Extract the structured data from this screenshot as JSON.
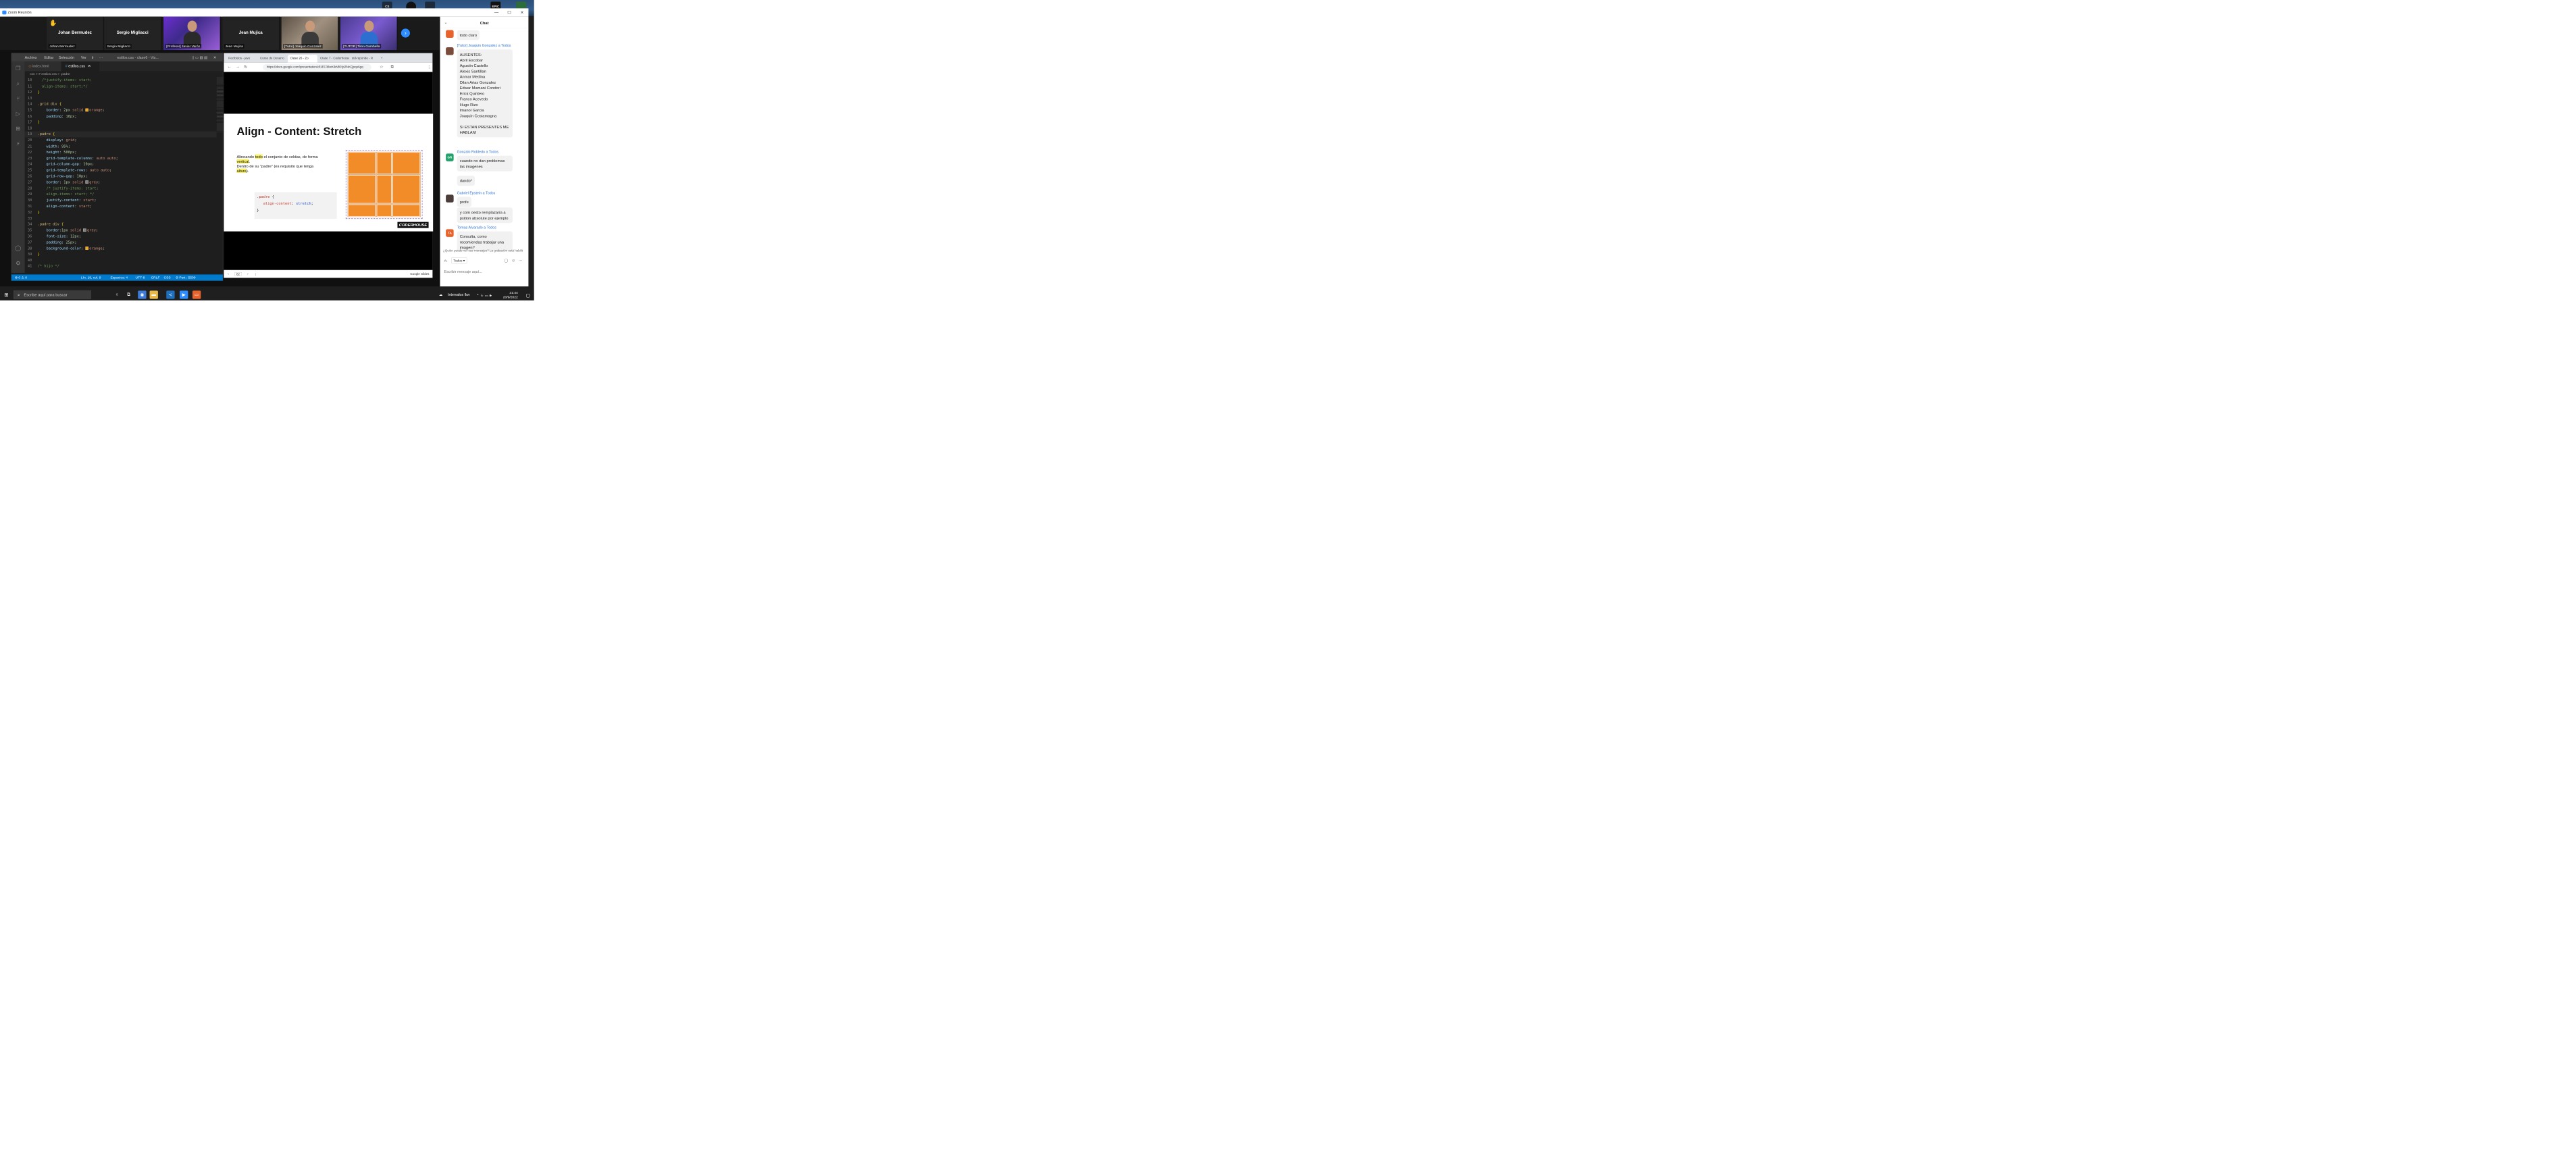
{
  "zoom": {
    "window_title": "Zoom Reunión",
    "minimize": "—",
    "maximize": "☐",
    "close": "✕"
  },
  "desktop": {
    "icons": [
      "CS",
      "",
      "EPIC",
      ""
    ]
  },
  "participants": [
    {
      "name": "Johan Bermudez",
      "tag": "Johan Bermudez",
      "hand": "✋"
    },
    {
      "name": "Sergio Migliacci",
      "tag": "Sergio Migliacci"
    },
    {
      "name": "",
      "tag": "[Profesor] Javier Varón"
    },
    {
      "name": "Jean Mujica",
      "tag": "Jean Mujica"
    },
    {
      "name": "",
      "tag": "[Tutor] Joaquin Gonzalez"
    },
    {
      "name": "",
      "tag": "[TUTOR] Timo Gambella"
    }
  ],
  "vscode": {
    "menu": [
      "Archivo",
      "Editar",
      "Selección",
      "Ver",
      "Ir",
      "···"
    ],
    "title": "estilos.css - clase6 - Vis...",
    "tabs": [
      "index.html",
      "estilos.css"
    ],
    "breadcrumb": "css > # estilos.css > .padre",
    "code_lines": [
      {
        "n": "10",
        "html": "<span class='tok-com'>  /*justify-items: start;</span>"
      },
      {
        "n": "11",
        "html": "<span class='tok-com'>  align-items: start;*/</span>"
      },
      {
        "n": "12",
        "html": "<span class='tok-brace'>}</span>"
      },
      {
        "n": "13",
        "html": ""
      },
      {
        "n": "14",
        "html": "<span class='tok-sel'>.grid div</span> <span class='tok-brace'>{</span>"
      },
      {
        "n": "15",
        "html": "    <span class='tok-prop'>border</span>: <span class='tok-num'>2px</span> <span class='tok-val'>solid</span> <span class='swatch' style='background:#ffa500'></span><span class='tok-val'>orange</span>;"
      },
      {
        "n": "16",
        "html": "    <span class='tok-prop'>padding</span>: <span class='tok-num'>10px</span>;"
      },
      {
        "n": "17",
        "html": "<span class='tok-brace'>}</span>"
      },
      {
        "n": "18",
        "html": ""
      },
      {
        "n": "19",
        "html": "<span class='tok-sel'>.padre</span> <span class='tok-brace'>{</span>"
      },
      {
        "n": "20",
        "html": "    <span class='tok-prop'>display</span>: <span class='tok-val'>grid</span>;"
      },
      {
        "n": "21",
        "html": "    <span class='tok-prop'>width</span>: <span class='tok-num'>95%</span>;"
      },
      {
        "n": "22",
        "html": "    <span class='tok-prop'>height</span>: <span class='tok-num'>500px</span>;"
      },
      {
        "n": "23",
        "html": "    <span class='tok-prop'>grid-template-columns</span>: <span class='tok-val'>auto auto</span>;"
      },
      {
        "n": "24",
        "html": "    <span class='tok-prop'>grid-column-gap</span>: <span class='tok-num'>10px</span>;"
      },
      {
        "n": "25",
        "html": "    <span class='tok-prop'>grid-template-rows</span>: <span class='tok-val'>auto auto</span>;"
      },
      {
        "n": "26",
        "html": "    <span class='tok-prop'>grid-row-gap</span>: <span class='tok-num'>10px</span>;"
      },
      {
        "n": "27",
        "html": "    <span class='tok-prop'>border</span>: <span class='tok-num'>1px</span> <span class='tok-val'>solid</span> <span class='swatch' style='background:#808080'></span><span class='tok-val'>grey</span>;"
      },
      {
        "n": "28",
        "html": "    <span class='tok-com'>/* justify-items: start;</span>"
      },
      {
        "n": "29",
        "html": "<span class='tok-com'>    align-items: start; */</span>"
      },
      {
        "n": "30",
        "html": "    <span class='tok-prop'>justify-content</span>: <span class='tok-val'>start</span>;"
      },
      {
        "n": "31",
        "html": "    <span class='tok-prop'>align-content</span>: <span class='tok-val'>start</span>;"
      },
      {
        "n": "32",
        "html": "<span class='tok-brace'>}</span>"
      },
      {
        "n": "33",
        "html": ""
      },
      {
        "n": "34",
        "html": "<span class='tok-sel'>.padre div</span> <span class='tok-brace'>{</span>"
      },
      {
        "n": "35",
        "html": "    <span class='tok-prop'>border</span>:<span class='tok-num'>1px</span> <span class='tok-val'>solid</span> <span class='swatch' style='background:#808080'></span><span class='tok-val'>grey</span>;"
      },
      {
        "n": "36",
        "html": "    <span class='tok-prop'>font-size</span>: <span class='tok-num'>12px</span>;"
      },
      {
        "n": "37",
        "html": "    <span class='tok-prop'>padding</span>: <span class='tok-num'>25px</span>;"
      },
      {
        "n": "38",
        "html": "    <span class='tok-prop'>background-color</span>: <span class='swatch' style='background:#ffa500'></span><span class='tok-val'>orange</span>;"
      },
      {
        "n": "39",
        "html": "<span class='tok-brace'>}</span>"
      },
      {
        "n": "40",
        "html": ""
      },
      {
        "n": "41",
        "html": "<span class='tok-com'>/* hijo */</span>"
      }
    ],
    "status": {
      "problems": "⊗ 0 ⚠ 0",
      "position": "Lín. 19, col. 9",
      "spaces": "Espacios: 4",
      "encoding": "UTF-8",
      "eol": "CRLF",
      "language": "CSS",
      "port": "⊘ Port : 5500"
    }
  },
  "chrome": {
    "tabs": [
      "Recibidos - javo",
      "Curso de Desarro",
      "Clase 26 - Zo",
      "Clase 7 - Coderhouse",
      "sid-reponde - R"
    ],
    "url": "https://docs.google.com/presentation/d/1EC3ikxKIkNfOfyiZNKQpqo6gq",
    "slide": {
      "title": "Align - Content: Stretch",
      "text_html": "Alineando <span class='hl'>todo</span> el conjunto de celdas, de forma <span class='hl'>vertical</span>.<br>Dentro de su \"padre\" (es requisito que tenga <span class='hl'>altura</span>).",
      "code_html": "<span class='c-red'>.padre</span> {\n   <span class='c-red'>align-content</span>: <span class='c-blue'>stretch</span>;\n}",
      "logo": "CODERHOUSE"
    },
    "slides_bar": {
      "page": "82",
      "label": "Google Slides"
    }
  },
  "chat": {
    "title": "Chat",
    "messages": [
      {
        "sender": "",
        "avatar": "",
        "avatar_color": "#e8632b",
        "text": "todo claro"
      },
      {
        "sender": "[Tutor] Joaquin Gonzalez a Todos",
        "avatar": "",
        "avatar_color": "#7a4b3a",
        "text": "AUSENTES:\nAbril Escobar\nAgustin Castello\nAlexis Santillan\nAnmar Medina\nDilan Arias Gonzalez\nEdwar Mamani Condori\nErick Quintero\nFranco Acevedo\nHugo Rizo\nImanol Garcia\nJoaquin Costamagna\n\nSI ESTAN PRESENTES ME HABLAN!"
      },
      {
        "sender": "Gonzalo Robledo a Todos",
        "avatar": "GR",
        "avatar_color": "#23a36b",
        "text": "cuando no dan problemas las imagenes"
      },
      {
        "sender": "",
        "avatar": "",
        "avatar_color": "",
        "text": "dando*"
      },
      {
        "sender": "Gabriel Epstein a Todos",
        "avatar": "",
        "avatar_color": "#4a3d3a",
        "text": "profe"
      },
      {
        "sender": "",
        "avatar": "",
        "avatar_color": "",
        "text": "y com oesto remplazaría a psition absolute por ejemplo"
      },
      {
        "sender": "Tomas Alvarado a Todos",
        "avatar": "TA",
        "avatar_color": "#e8632b",
        "text": "Consulta, como recomiendas trabajar una imagen?"
      }
    ],
    "notice": "¿Quién puede ver sus mensajes? La grabación está habilit",
    "to_label": "A:",
    "recipient": "Todos ▾",
    "input_placeholder": "Escribir mensaje aquí..."
  },
  "taskbar": {
    "search_placeholder": "Escribe aquí para buscar",
    "weather": "Intervalos lluv",
    "time": "21:44",
    "date": "20/9/2022",
    "inner_time": "08:44 p. m.",
    "inner_date": "20/09/2022"
  }
}
